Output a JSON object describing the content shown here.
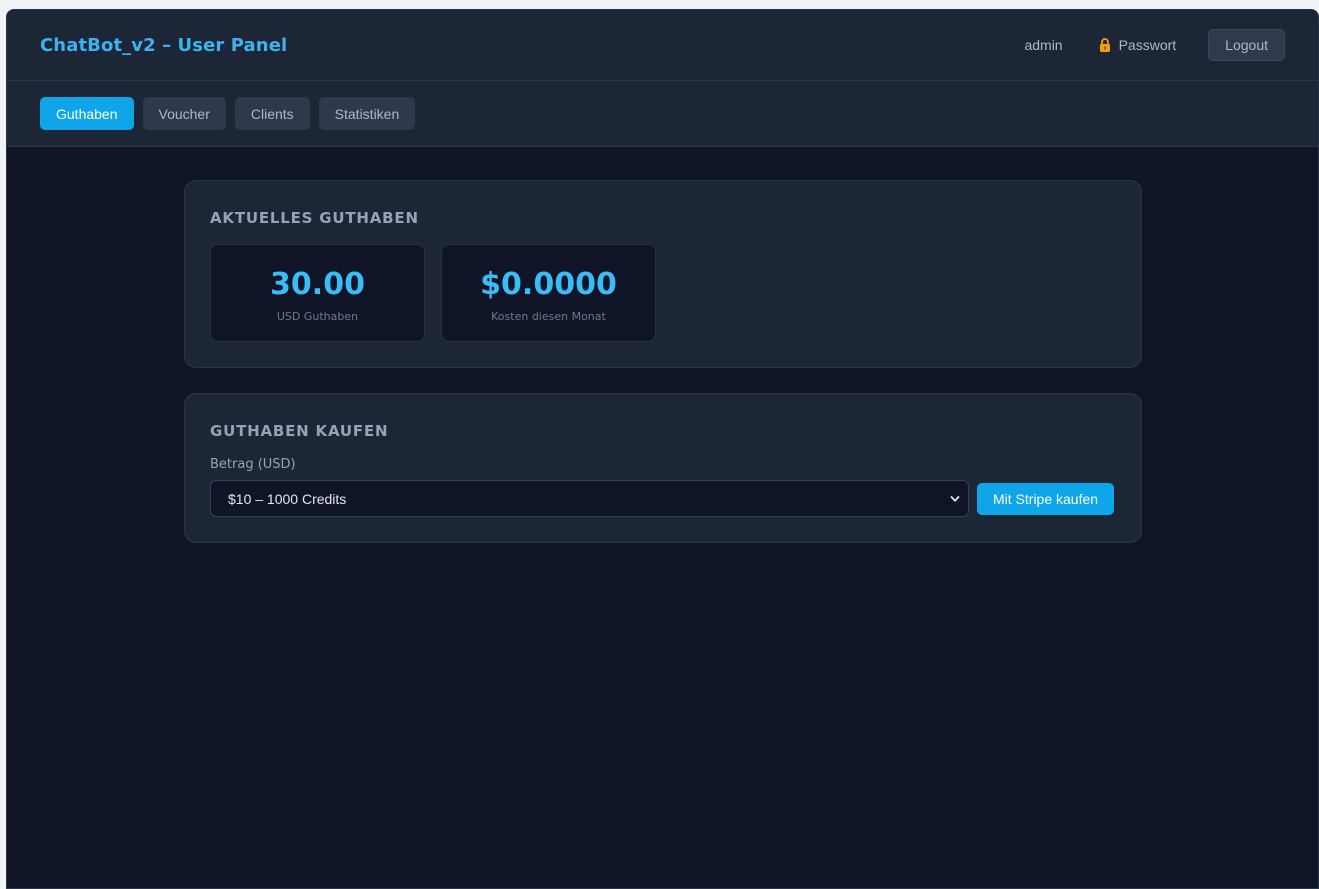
{
  "header": {
    "title": "ChatBot_v2 – User Panel",
    "username": "admin",
    "password_label": "Passwort",
    "logout_label": "Logout"
  },
  "tabs": [
    {
      "label": "Guthaben",
      "active": true
    },
    {
      "label": "Voucher",
      "active": false
    },
    {
      "label": "Clients",
      "active": false
    },
    {
      "label": "Statistiken",
      "active": false
    }
  ],
  "balance_card": {
    "title": "AKTUELLES GUTHABEN",
    "stats": [
      {
        "value": "30.00",
        "label": "USD Guthaben"
      },
      {
        "value": "$0.0000",
        "label": "Kosten diesen Monat"
      }
    ]
  },
  "buy_card": {
    "title": "GUTHABEN KAUFEN",
    "amount_label": "Betrag (USD)",
    "selected_option": "$10 – 1000 Credits",
    "buy_button_label": "Mit Stripe kaufen"
  },
  "colors": {
    "accent": "#0ea5e9",
    "title": "#3ab3f1",
    "value": "#38bdf8",
    "background": "#0f1426",
    "panel": "#1d2636",
    "lock": "#f59e0b"
  },
  "icons": {
    "password": "lock-icon",
    "select": "chevron-down-icon"
  }
}
